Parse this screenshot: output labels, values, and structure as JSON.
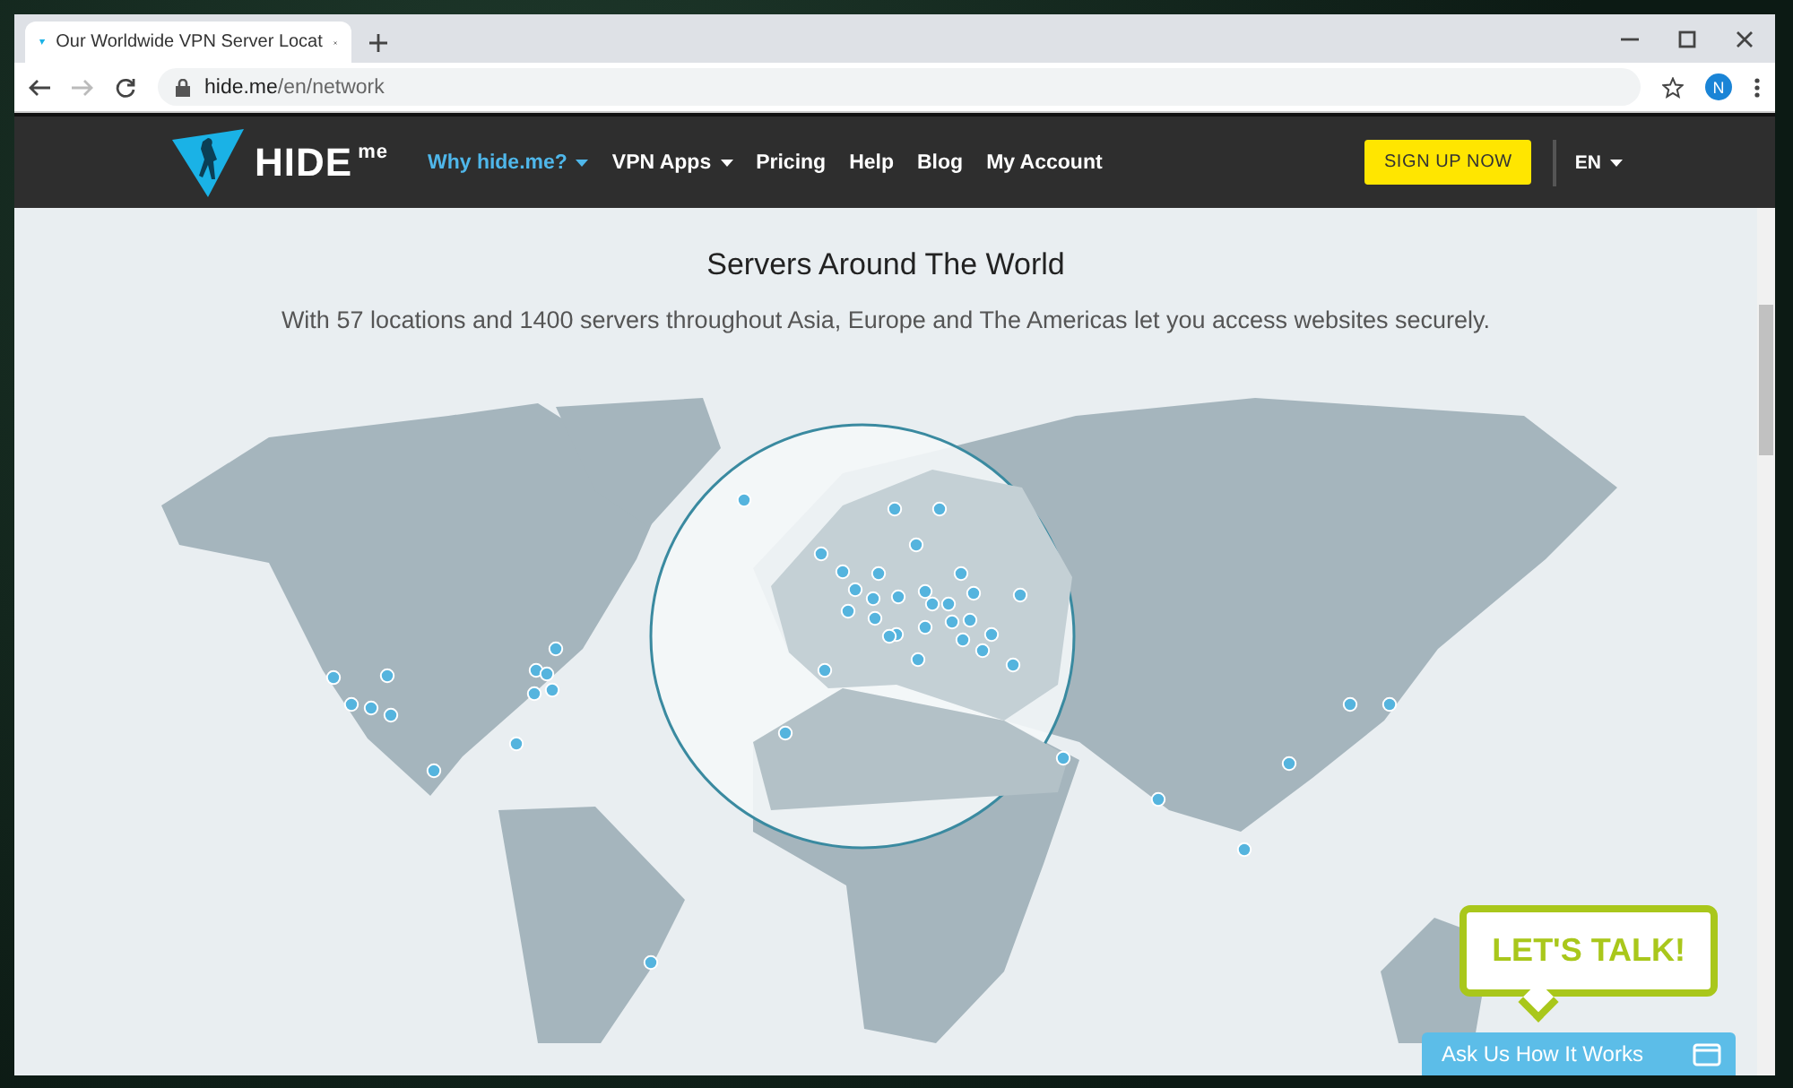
{
  "browser": {
    "tab_title": "Our Worldwide VPN Server Locat",
    "url_host": "hide.me",
    "url_path": "/en/network",
    "profile_initial": "N"
  },
  "nav": {
    "logo_text": "HIDE",
    "logo_sup": "me",
    "items": [
      {
        "label": "Why hide.me?",
        "dropdown": true,
        "selected": true
      },
      {
        "label": "VPN Apps",
        "dropdown": true,
        "selected": false
      },
      {
        "label": "Pricing",
        "dropdown": false,
        "selected": false
      },
      {
        "label": "Help",
        "dropdown": false,
        "selected": false
      },
      {
        "label": "Blog",
        "dropdown": false,
        "selected": false
      },
      {
        "label": "My Account",
        "dropdown": false,
        "selected": false
      }
    ],
    "cta": "SIGN UP NOW",
    "language": "EN"
  },
  "hero": {
    "title": "Servers Around The World",
    "subtitle": "With 57 locations and 1400 servers throughout Asia, Europe and The Americas let you access websites securely."
  },
  "chat": {
    "bubble": "LET'S TALK!",
    "bar": "Ask Us How It Works"
  }
}
